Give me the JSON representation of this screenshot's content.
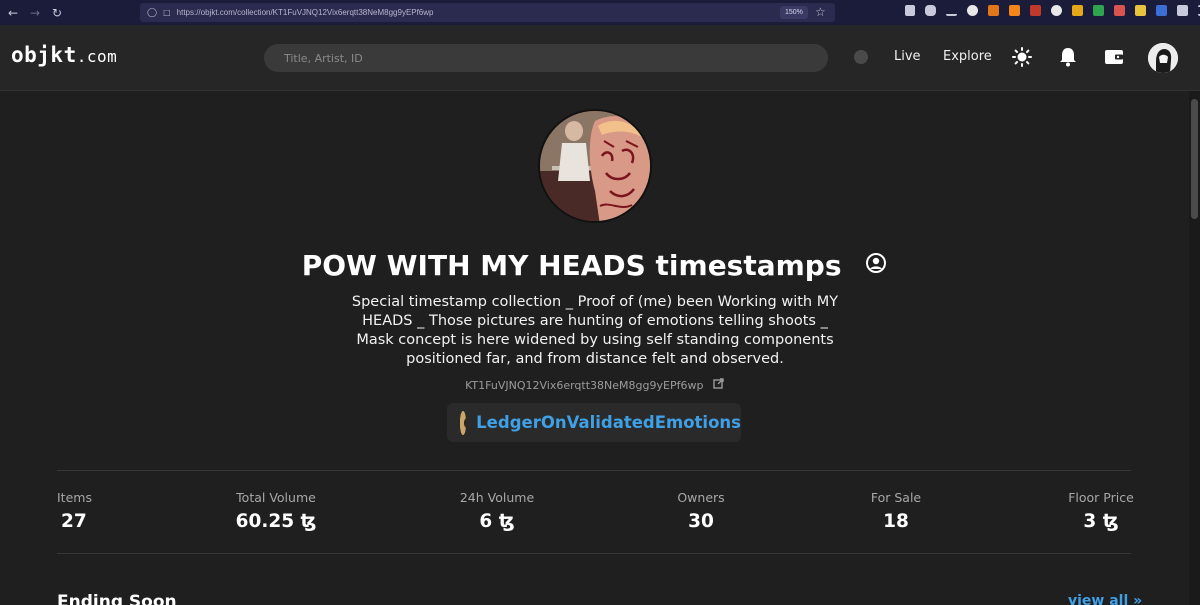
{
  "browser": {
    "url": "https://objkt.com/collection/KT1FuVJNQ12Vix6erqtt38NeM8gg9yEPf6wp",
    "zoom": "150%"
  },
  "header": {
    "logo_main": "objkt",
    "logo_suffix": ".com",
    "search_placeholder": "Title, Artist, ID",
    "nav_live": "Live",
    "nav_explore": "Explore"
  },
  "collection": {
    "title": "POW WITH MY HEADS timestamps",
    "description": "Special timestamp collection _ Proof of (me) been Working with MY HEADS _ Those pictures are hunting of emotions telling shoots _ Mask concept is here widened by using self standing components positioned far, and from distance felt and observed.",
    "contract": "KT1FuVJNQ12Vix6erqtt38NeM8gg9yEPf6wp",
    "creator": "LedgerOnValidatedEmotions"
  },
  "stats": [
    {
      "label": "Items",
      "value": "27"
    },
    {
      "label": "Total Volume",
      "value": "60.25 ꜩ"
    },
    {
      "label": "24h Volume",
      "value": "6 ꜩ"
    },
    {
      "label": "Owners",
      "value": "30"
    },
    {
      "label": "For Sale",
      "value": "18"
    },
    {
      "label": "Floor Price",
      "value": "3 ꜩ"
    }
  ],
  "section": {
    "title": "Ending Soon",
    "view_all": "view all »"
  },
  "colors": {
    "accent": "#3fa0e6",
    "background": "#1f1f1f",
    "header": "#262626"
  },
  "icons": [
    "theme-sun-icon",
    "bell-icon",
    "wallet-icon",
    "user-circle-icon",
    "external-link-icon"
  ]
}
